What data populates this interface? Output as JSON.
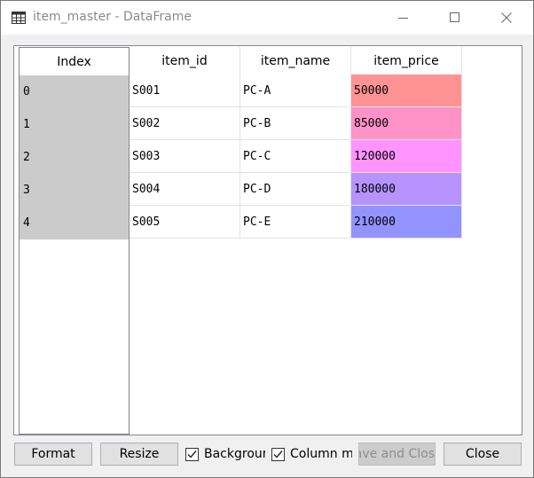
{
  "window": {
    "title": "item_master - DataFrame"
  },
  "icons": {
    "app": "table-grid-icon",
    "minimize": "minimize-icon",
    "maximize": "maximize-icon",
    "close": "close-icon",
    "checkmark": "checkmark-icon"
  },
  "table": {
    "index_header": "Index",
    "columns": [
      "item_id",
      "item_name",
      "item_price"
    ],
    "index": [
      "0",
      "1",
      "2",
      "3",
      "4"
    ],
    "rows": [
      [
        "S001",
        "PC-A",
        "50000"
      ],
      [
        "S002",
        "PC-B",
        "85000"
      ],
      [
        "S003",
        "PC-C",
        "120000"
      ],
      [
        "S004",
        "PC-D",
        "180000"
      ],
      [
        "S005",
        "PC-E",
        "210000"
      ]
    ],
    "price_colors": [
      "#ff9393",
      "#ff93c8",
      "#ff93ff",
      "#b793ff",
      "#9393ff"
    ]
  },
  "buttons": {
    "format": "Format",
    "resize": "Resize",
    "background": "Backgrour",
    "column_min": "Column mi",
    "save_and_close": "ave and Clos",
    "close": "Close"
  },
  "checkboxes": {
    "background_checked": true,
    "column_min_checked": true
  }
}
